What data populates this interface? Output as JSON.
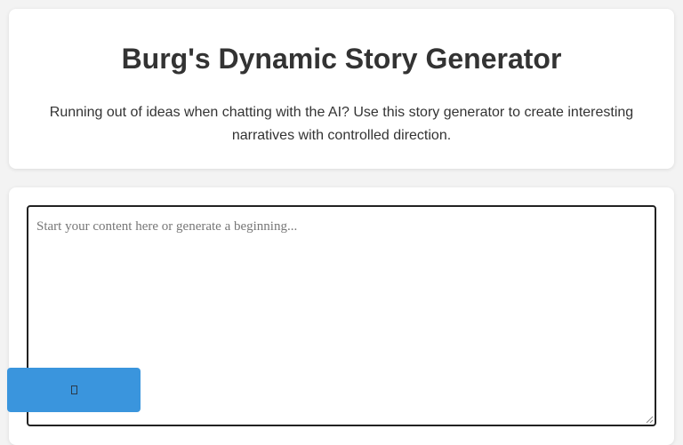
{
  "header": {
    "title": "Burg's Dynamic Story Generator",
    "subtitle": "Running out of ideas when chatting with the AI? Use this story generator to create interesting narratives with controlled direction."
  },
  "editor": {
    "value": "",
    "placeholder": "Start your content here or generate a beginning..."
  },
  "floating_button": {
    "icon": "missing-glyph-icon",
    "color": "#3a95dd"
  },
  "colors": {
    "page_background": "#f3f3f3",
    "card_background": "#ffffff",
    "text": "#333333",
    "accent": "#3a95dd"
  }
}
